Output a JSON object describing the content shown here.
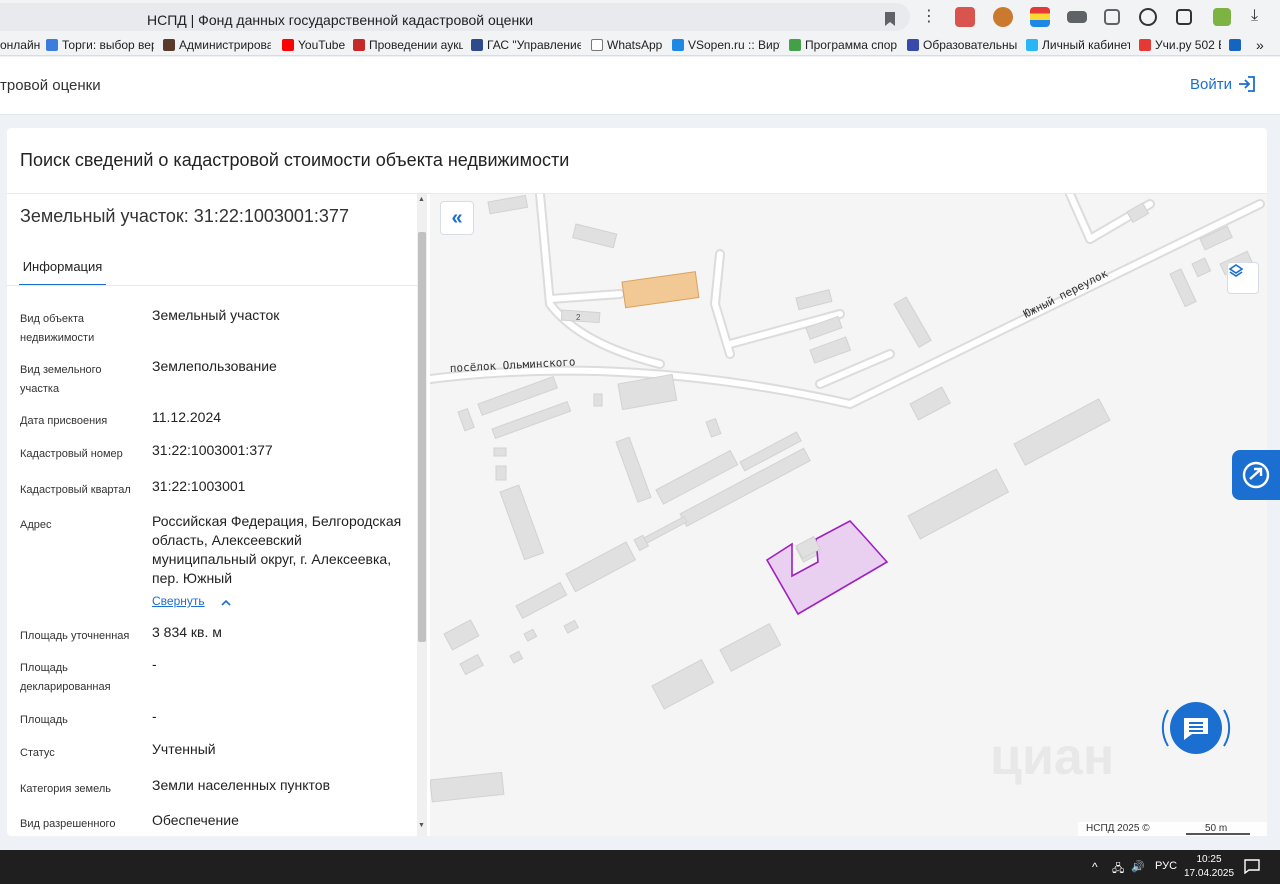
{
  "browser": {
    "tab_title": "НСПД | Фонд данных государственной кадастровой оценки",
    "bookmarks": [
      {
        "label": "онлайн",
        "color": "#ffffff"
      },
      {
        "label": "Торги: выбор вер",
        "color": "#3b7ddd"
      },
      {
        "label": "Администрирова",
        "color": "#5a3b2a"
      },
      {
        "label": "YouTube",
        "color": "#ff0000"
      },
      {
        "label": "Проведении аукц",
        "color": "#c62828"
      },
      {
        "label": "ГАС \"Управление",
        "color": "#2c4a8c"
      },
      {
        "label": "WhatsApp",
        "color": "#ffffff"
      },
      {
        "label": "VSopen.ru :: Вирту",
        "color": "#1e88e5"
      },
      {
        "label": "Программа спорт",
        "color": "#43a047"
      },
      {
        "label": "Образовательный",
        "color": "#3949ab"
      },
      {
        "label": "Личный кабинет",
        "color": "#29b6f6"
      },
      {
        "label": "Учи.ру 502 E",
        "color": "#e53935"
      }
    ],
    "more_bookmarks": "»"
  },
  "site": {
    "title": "тровой оценки",
    "login_label": "Войти"
  },
  "card": {
    "title": "Поиск сведений о кадастровой стоимости объекта недвижимости"
  },
  "object": {
    "title": "Земельный участок: 31:22:1003001:377",
    "tab": "Информация",
    "collapse_label": "Свернуть",
    "fields": [
      {
        "label": "Вид объекта недвижимости",
        "value": "Земельный участок"
      },
      {
        "label": "Вид земельного участка",
        "value": "Землепользование"
      },
      {
        "label": "Дата присвоения",
        "value": "11.12.2024"
      },
      {
        "label": "Кадастровый номер",
        "value": "31:22:1003001:377"
      },
      {
        "label": "Кадастровый квартал",
        "value": "31:22:1003001"
      },
      {
        "label": "Адрес",
        "value": "Российская Федерация, Белгородская область, Алексеевский муниципальный округ, г. Алексеевка, пер. Южный"
      },
      {
        "label": "Площадь уточненная",
        "value": "3 834 кв. м"
      },
      {
        "label": "Площадь декларированная",
        "value": "-"
      },
      {
        "label": "Площадь",
        "value": "-"
      },
      {
        "label": "Статус",
        "value": "Учтенный"
      },
      {
        "label": "Категория земель",
        "value": "Земли населенных пунктов"
      },
      {
        "label": "Вид разрешенного",
        "value": "Обеспечение"
      }
    ]
  },
  "map": {
    "street_1": "посёлок Ольминского",
    "street_2": "Южный переулок",
    "house_number": "2",
    "attribution": "НСПД 2025 ©",
    "scale": "50 m",
    "watermark": "циан",
    "colors": {
      "parcel_stroke": "#a020c0",
      "parcel_fill": "#e6c8ee",
      "highlight": "#f2c894",
      "building": "#e0e0e0"
    }
  },
  "taskbar": {
    "lang": "РУС",
    "time": "10:25",
    "date": "17.04.2025"
  }
}
